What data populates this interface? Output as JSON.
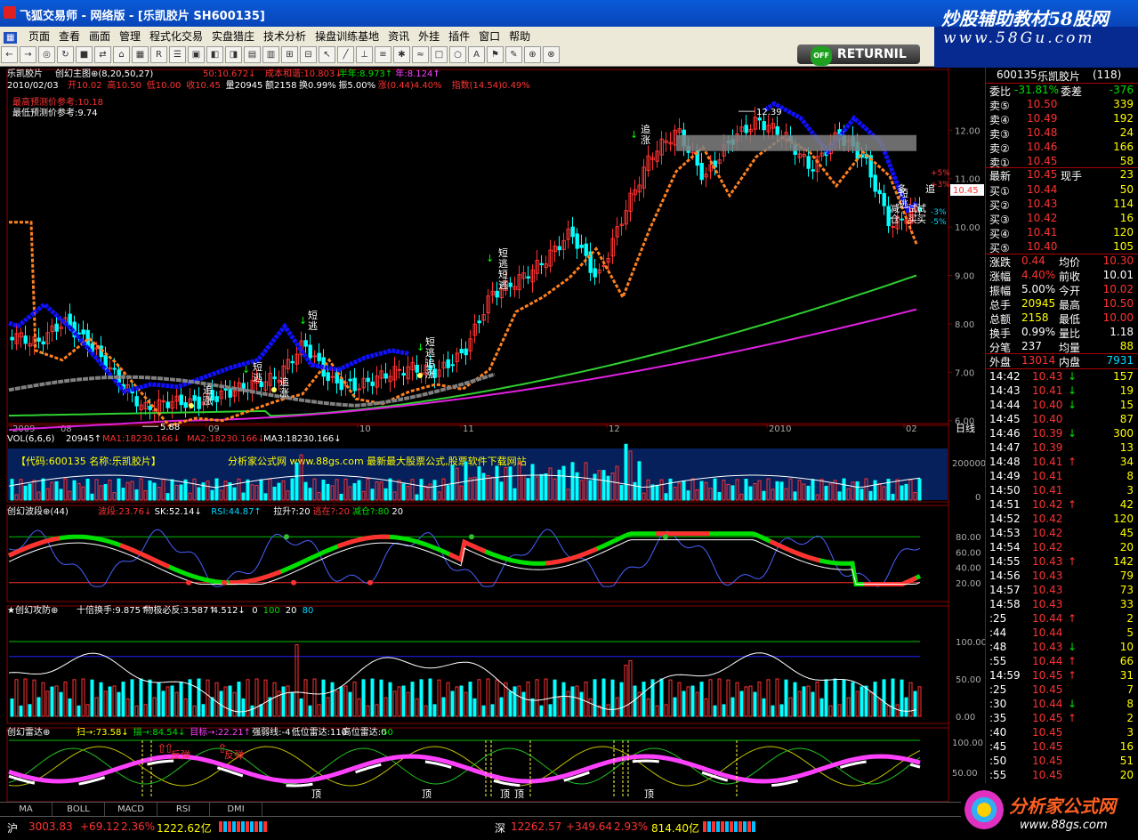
{
  "window": {
    "title": "飞狐交易师 - 网络版 - [乐凯胶片 SH600135]",
    "brand_top": "炒股辅助教材58股网",
    "brand_url": "www.58Gu.com"
  },
  "menu": [
    "页面",
    "查看",
    "画面",
    "管理",
    "程式化交易",
    "实盘猎庄",
    "技术分析",
    "操盘训练基地",
    "资讯",
    "外挂",
    "插件",
    "窗口",
    "帮助"
  ],
  "toolbar": {
    "return_label": "RETURNIL",
    "off_label": "OFF",
    "quan_label": "权"
  },
  "main": {
    "name_line": "乐凯胶片",
    "indicator": "创幻主图⊕(8,20,50,27)",
    "ind_vals": [
      {
        "t": "50:10.672↓",
        "c": "red"
      },
      {
        "t": "成本和谐:10.803↓",
        "c": "red"
      },
      {
        "t": "半年:8.973↑",
        "c": "grn"
      },
      {
        "t": "年:8.124↑",
        "c": "mag"
      }
    ],
    "date": "2010/02/03",
    "ohlc": [
      {
        "t": "开10.02",
        "c": "red"
      },
      {
        "t": "高10.50",
        "c": "red"
      },
      {
        "t": "低10.00",
        "c": "red"
      },
      {
        "t": "收10.45",
        "c": "red"
      },
      {
        "t": "量20945",
        "c": "wht"
      },
      {
        "t": "额2158",
        "c": "wht"
      },
      {
        "t": "换0.99%",
        "c": "wht"
      },
      {
        "t": "振5.00%",
        "c": "wht"
      },
      {
        "t": "涨(0.44)4.40%",
        "c": "red"
      },
      {
        "t": "指数(14.54)0.49%",
        "c": "red"
      }
    ],
    "pred_high": "最高预测价参考:10.18",
    "pred_low": "最低预测价参考:9.74",
    "high_label": "12.39",
    "low_label": "5.88",
    "y_ticks": [
      "12.00",
      "11.00",
      "10.00",
      "9.00",
      "8.00",
      "7.00",
      "6.00"
    ],
    "pct_labels": [
      "+5%",
      "+3%",
      "-3%",
      "-5%"
    ],
    "cur_price": "10.45",
    "x_ticks": [
      "2009",
      "08",
      "09",
      "10",
      "11",
      "12",
      "2010",
      "02"
    ],
    "period": "日线",
    "tags": [
      "短",
      "逃",
      "追",
      "涨",
      "追",
      "涨",
      "短",
      "逃",
      "短",
      "逃",
      "追",
      "涨",
      "短",
      "逃",
      "追",
      "涨",
      "短",
      "逃",
      "短",
      "逃",
      "减",
      "仓",
      "试",
      "买",
      "试",
      "买",
      "多",
      "追"
    ]
  },
  "vol": {
    "header": "VOL(6,6,6)",
    "v": "20945↑",
    "ma1": "MA1:18230.166↓",
    "ma2": "MA2:18230.166↓",
    "ma3": "MA3:18230.166↓",
    "banner1": "【代码:600135 名称:乐凯胶片】",
    "banner2": "分析家公式网 www.88gs.com 最新最大股票公式,股票软件下载网站",
    "y_ticks": [
      "200000",
      "0"
    ]
  },
  "wave": {
    "header": "创幻波段⊕(44)",
    "vals": [
      {
        "t": "波段:23.76↓",
        "c": "red"
      },
      {
        "t": "SK:52.14↓",
        "c": "wht"
      },
      {
        "t": "RSI:44.87↑",
        "c": "cyan"
      },
      {
        "t": "拉升?:20",
        "c": "wht"
      },
      {
        "t": "逃在?:20",
        "c": "red"
      },
      {
        "t": "减仓?:80",
        "c": "grn"
      },
      {
        "t": "20",
        "c": "wht"
      }
    ],
    "y_ticks": [
      "80.00",
      "60.00",
      "40.00",
      "20.00"
    ]
  },
  "attack": {
    "header": "★创幻攻防⊕",
    "vals": [
      {
        "t": "十倍换手:9.875↑",
        "c": "wht"
      },
      {
        "t": "物极必反:3.587↑",
        "c": "wht"
      },
      {
        "t": "4.512↓",
        "c": "wht"
      },
      {
        "t": "0",
        "c": "wht"
      },
      {
        "t": "100",
        "c": "grn"
      },
      {
        "t": "20",
        "c": "wht"
      },
      {
        "t": "80",
        "c": "cyan"
      }
    ],
    "y_ticks": [
      "100.00",
      "50.00",
      "0.00"
    ]
  },
  "radar": {
    "header": "创幻雷达⊕",
    "vals": [
      {
        "t": "扫→:73.58↓",
        "c": "yel"
      },
      {
        "t": "描→:84.54↓",
        "c": "grn"
      },
      {
        "t": "目标→:22.21↑",
        "c": "mag"
      },
      {
        "t": "强弱线:-4",
        "c": "wht"
      },
      {
        "t": "低位雷达:110",
        "c": "wht"
      },
      {
        "t": "高位雷达:0",
        "c": "wht"
      },
      {
        "t": "50",
        "c": "grn"
      }
    ],
    "y_ticks": [
      "100.00",
      "50.00"
    ],
    "tags": [
      "反弹",
      "反弹",
      "顶",
      "顶",
      "顶",
      "顶",
      "顶"
    ]
  },
  "bottom_tabs": [
    "MA",
    "BOLL",
    "MACD",
    "RSI",
    "DMI"
  ],
  "quote": {
    "code": "600135",
    "name": "乐凯胶片",
    "count": "(118)",
    "weibi_l": "委比",
    "weibi_v": "-31.81%",
    "weicha_l": "委差",
    "weicha_v": "-376",
    "sells": [
      {
        "l": "卖⑤",
        "p": "10.50",
        "v": "339"
      },
      {
        "l": "卖④",
        "p": "10.49",
        "v": "192"
      },
      {
        "l": "卖③",
        "p": "10.48",
        "v": "24"
      },
      {
        "l": "卖②",
        "p": "10.46",
        "v": "166"
      },
      {
        "l": "卖①",
        "p": "10.45",
        "v": "58"
      }
    ],
    "latest": {
      "l": "最新",
      "p": "10.45",
      "l2": "现手",
      "v": "23"
    },
    "buys": [
      {
        "l": "买①",
        "p": "10.44",
        "v": "50"
      },
      {
        "l": "买②",
        "p": "10.43",
        "v": "114"
      },
      {
        "l": "买③",
        "p": "10.42",
        "v": "16"
      },
      {
        "l": "买④",
        "p": "10.41",
        "v": "120"
      },
      {
        "l": "买⑤",
        "p": "10.40",
        "v": "105"
      }
    ],
    "stats": [
      {
        "l1": "涨跌",
        "v1": "0.44",
        "c1": "red",
        "l2": "均价",
        "v2": "10.30",
        "c2": "red"
      },
      {
        "l1": "涨幅",
        "v1": "4.40%",
        "c1": "red",
        "l2": "前收",
        "v2": "10.01",
        "c2": "wht"
      },
      {
        "l1": "振幅",
        "v1": "5.00%",
        "c1": "wht",
        "l2": "今开",
        "v2": "10.02",
        "c2": "red"
      },
      {
        "l1": "总手",
        "v1": "20945",
        "c1": "yel",
        "l2": "最高",
        "v2": "10.50",
        "c2": "red"
      },
      {
        "l1": "总额",
        "v1": "2158",
        "c1": "yel",
        "l2": "最低",
        "v2": "10.00",
        "c2": "red"
      },
      {
        "l1": "换手",
        "v1": "0.99%",
        "c1": "wht",
        "l2": "量比",
        "v2": "1.18",
        "c2": "wht"
      },
      {
        "l1": "分笔",
        "v1": "237",
        "c1": "wht",
        "l2": "均量",
        "v2": "88",
        "c2": "yel"
      }
    ],
    "outer": {
      "l1": "外盘",
      "v1": "13014",
      "l2": "内盘",
      "v2": "7931"
    },
    "ticks": [
      {
        "t": "14:42",
        "p": "10.43",
        "a": "↓",
        "v": "157",
        "c": "red"
      },
      {
        "t": "14:43",
        "p": "10.41",
        "a": "↓",
        "v": "19",
        "c": "red"
      },
      {
        "t": "14:44",
        "p": "10.40",
        "a": "↓",
        "v": "15",
        "c": "red"
      },
      {
        "t": "14:45",
        "p": "10.40",
        "a": "",
        "v": "87",
        "c": "red"
      },
      {
        "t": "14:46",
        "p": "10.39",
        "a": "↓",
        "v": "300",
        "c": "red"
      },
      {
        "t": "14:47",
        "p": "10.39",
        "a": "",
        "v": "13",
        "c": "red"
      },
      {
        "t": "14:48",
        "p": "10.41",
        "a": "↑",
        "v": "34",
        "c": "red"
      },
      {
        "t": "14:49",
        "p": "10.41",
        "a": "",
        "v": "8",
        "c": "red"
      },
      {
        "t": "14:50",
        "p": "10.41",
        "a": "",
        "v": "3",
        "c": "red"
      },
      {
        "t": "14:51",
        "p": "10.42",
        "a": "↑",
        "v": "42",
        "c": "red"
      },
      {
        "t": "14:52",
        "p": "10.42",
        "a": "",
        "v": "120",
        "c": "red"
      },
      {
        "t": "14:53",
        "p": "10.42",
        "a": "",
        "v": "45",
        "c": "red"
      },
      {
        "t": "14:54",
        "p": "10.42",
        "a": "",
        "v": "20",
        "c": "red"
      },
      {
        "t": "14:55",
        "p": "10.43",
        "a": "↑",
        "v": "142",
        "c": "red"
      },
      {
        "t": "14:56",
        "p": "10.43",
        "a": "",
        "v": "79",
        "c": "red"
      },
      {
        "t": "14:57",
        "p": "10.43",
        "a": "",
        "v": "73",
        "c": "red"
      },
      {
        "t": "14:58",
        "p": "10.43",
        "a": "",
        "v": "33",
        "c": "red"
      },
      {
        "t": ":25",
        "p": "10.44",
        "a": "↑",
        "v": "2",
        "c": "red"
      },
      {
        "t": ":44",
        "p": "10.44",
        "a": "",
        "v": "5",
        "c": "red"
      },
      {
        "t": ":48",
        "p": "10.43",
        "a": "↓",
        "v": "10",
        "c": "red"
      },
      {
        "t": ":55",
        "p": "10.44",
        "a": "↑",
        "v": "66",
        "c": "red"
      },
      {
        "t": "14:59",
        "p": "10.45",
        "a": "↑",
        "v": "31",
        "c": "red"
      },
      {
        "t": ":25",
        "p": "10.45",
        "a": "",
        "v": "7",
        "c": "red"
      },
      {
        "t": ":30",
        "p": "10.44",
        "a": "↓",
        "v": "8",
        "c": "red"
      },
      {
        "t": ":35",
        "p": "10.45",
        "a": "↑",
        "v": "2",
        "c": "red"
      },
      {
        "t": ":40",
        "p": "10.45",
        "a": "",
        "v": "3",
        "c": "red"
      },
      {
        "t": ":45",
        "p": "10.45",
        "a": "",
        "v": "16",
        "c": "red"
      },
      {
        "t": ":50",
        "p": "10.45",
        "a": "",
        "v": "51",
        "c": "red"
      },
      {
        "t": ":55",
        "p": "10.45",
        "a": "",
        "v": "20",
        "c": "red"
      },
      {
        "t": "15:00",
        "p": "10.45",
        "a": "",
        "v": "23",
        "c": "red"
      }
    ]
  },
  "status": {
    "sh_label": "沪",
    "sh_idx": "3003.83",
    "sh_chg": "+69.12",
    "sh_pct": "2.36%",
    "sh_amt": "1222.62亿",
    "sz_label": "深",
    "sz_idx": "12262.57",
    "sz_chg": "+349.64",
    "sz_pct": "2.93%",
    "sz_amt": "814.40亿",
    "logo": "分析家公式网",
    "logo_url": "www.88gs.com"
  },
  "colors": {
    "up": "#ff3232",
    "down": "#00ffff",
    "ma_green": "#30d030",
    "ma_mag": "#e020e0",
    "ma_blue": "#1010ff",
    "ma_orange": "#ff8020"
  }
}
